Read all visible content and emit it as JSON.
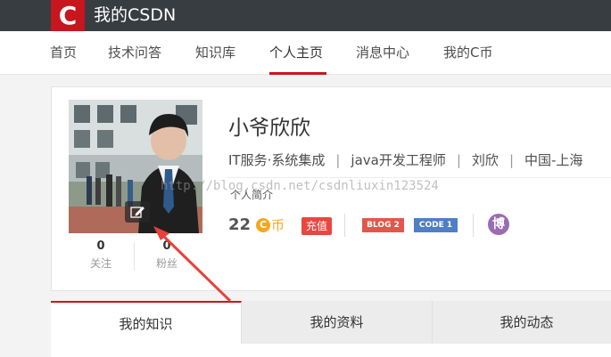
{
  "header": {
    "logo_letter": "C",
    "brand_title": "我的CSDN"
  },
  "nav": {
    "items": [
      {
        "label": "首页"
      },
      {
        "label": "技术问答"
      },
      {
        "label": "知识库"
      },
      {
        "label": "个人主页",
        "active": true
      },
      {
        "label": "消息中心"
      },
      {
        "label": "我的C币"
      }
    ]
  },
  "profile": {
    "username": "小爷欣欣",
    "industry": "IT服务·系统集成",
    "job": "java开发工程师",
    "real_name": "刘欣",
    "location": "中国-上海",
    "separator": "|",
    "intro_label": "个人简介",
    "watermark": "http://blog.csdn.net/csdnliuxin123524",
    "stats": {
      "follow_count": "0",
      "follow_label": "关注",
      "fans_count": "0",
      "fans_label": "粉丝"
    },
    "coins": {
      "amount": "22",
      "icon_letter": "C",
      "unit": "币",
      "recharge_label": "充值"
    },
    "badges": {
      "blog": "BLOG 2",
      "code": "CODE 1",
      "blog_icon_char": "博"
    }
  },
  "tabs": [
    {
      "label": "我的知识",
      "active": true
    },
    {
      "label": "我的资料"
    },
    {
      "label": "我的动态"
    }
  ],
  "colors": {
    "brand_red": "#c9151e",
    "topbar": "#373d41",
    "coin_orange": "#f4a81e",
    "arrow_red": "#e8413a"
  }
}
